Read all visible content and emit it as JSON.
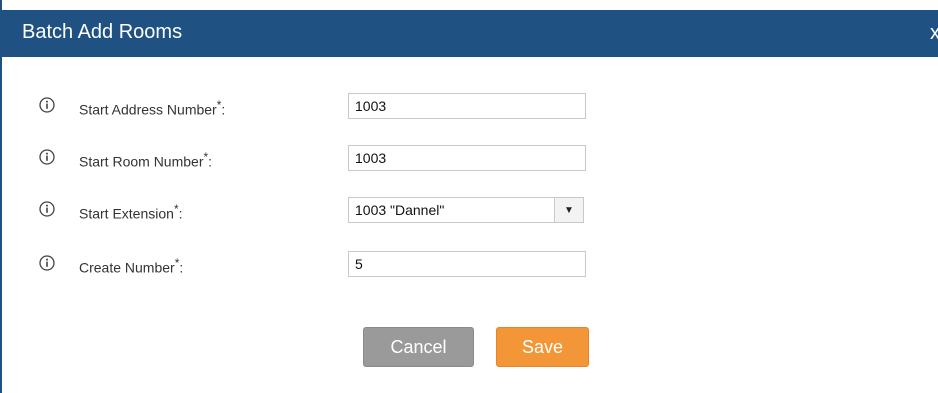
{
  "dialog": {
    "title": "Batch Add Rooms",
    "close_label": "x"
  },
  "form": {
    "fields": [
      {
        "label": "Start Address Number",
        "required_mark": "*",
        "colon": ":",
        "value": "1003"
      },
      {
        "label": "Start Room Number",
        "required_mark": "*",
        "colon": ":",
        "value": "1003"
      },
      {
        "label": "Start Extension",
        "required_mark": "*",
        "colon": ":",
        "value": "1003 \"Dannel\""
      },
      {
        "label": "Create Number",
        "required_mark": "*",
        "colon": ":",
        "value": "5"
      }
    ],
    "dropdown_arrow": "▼"
  },
  "buttons": {
    "cancel_label": "Cancel",
    "save_label": "Save"
  },
  "colors": {
    "title_bar": "#1f5282",
    "cancel_bg": "#9a9a9a",
    "save_bg": "#f39637"
  },
  "icons": {
    "info": "info-circle-icon",
    "dropdown": "caret-down-icon"
  }
}
